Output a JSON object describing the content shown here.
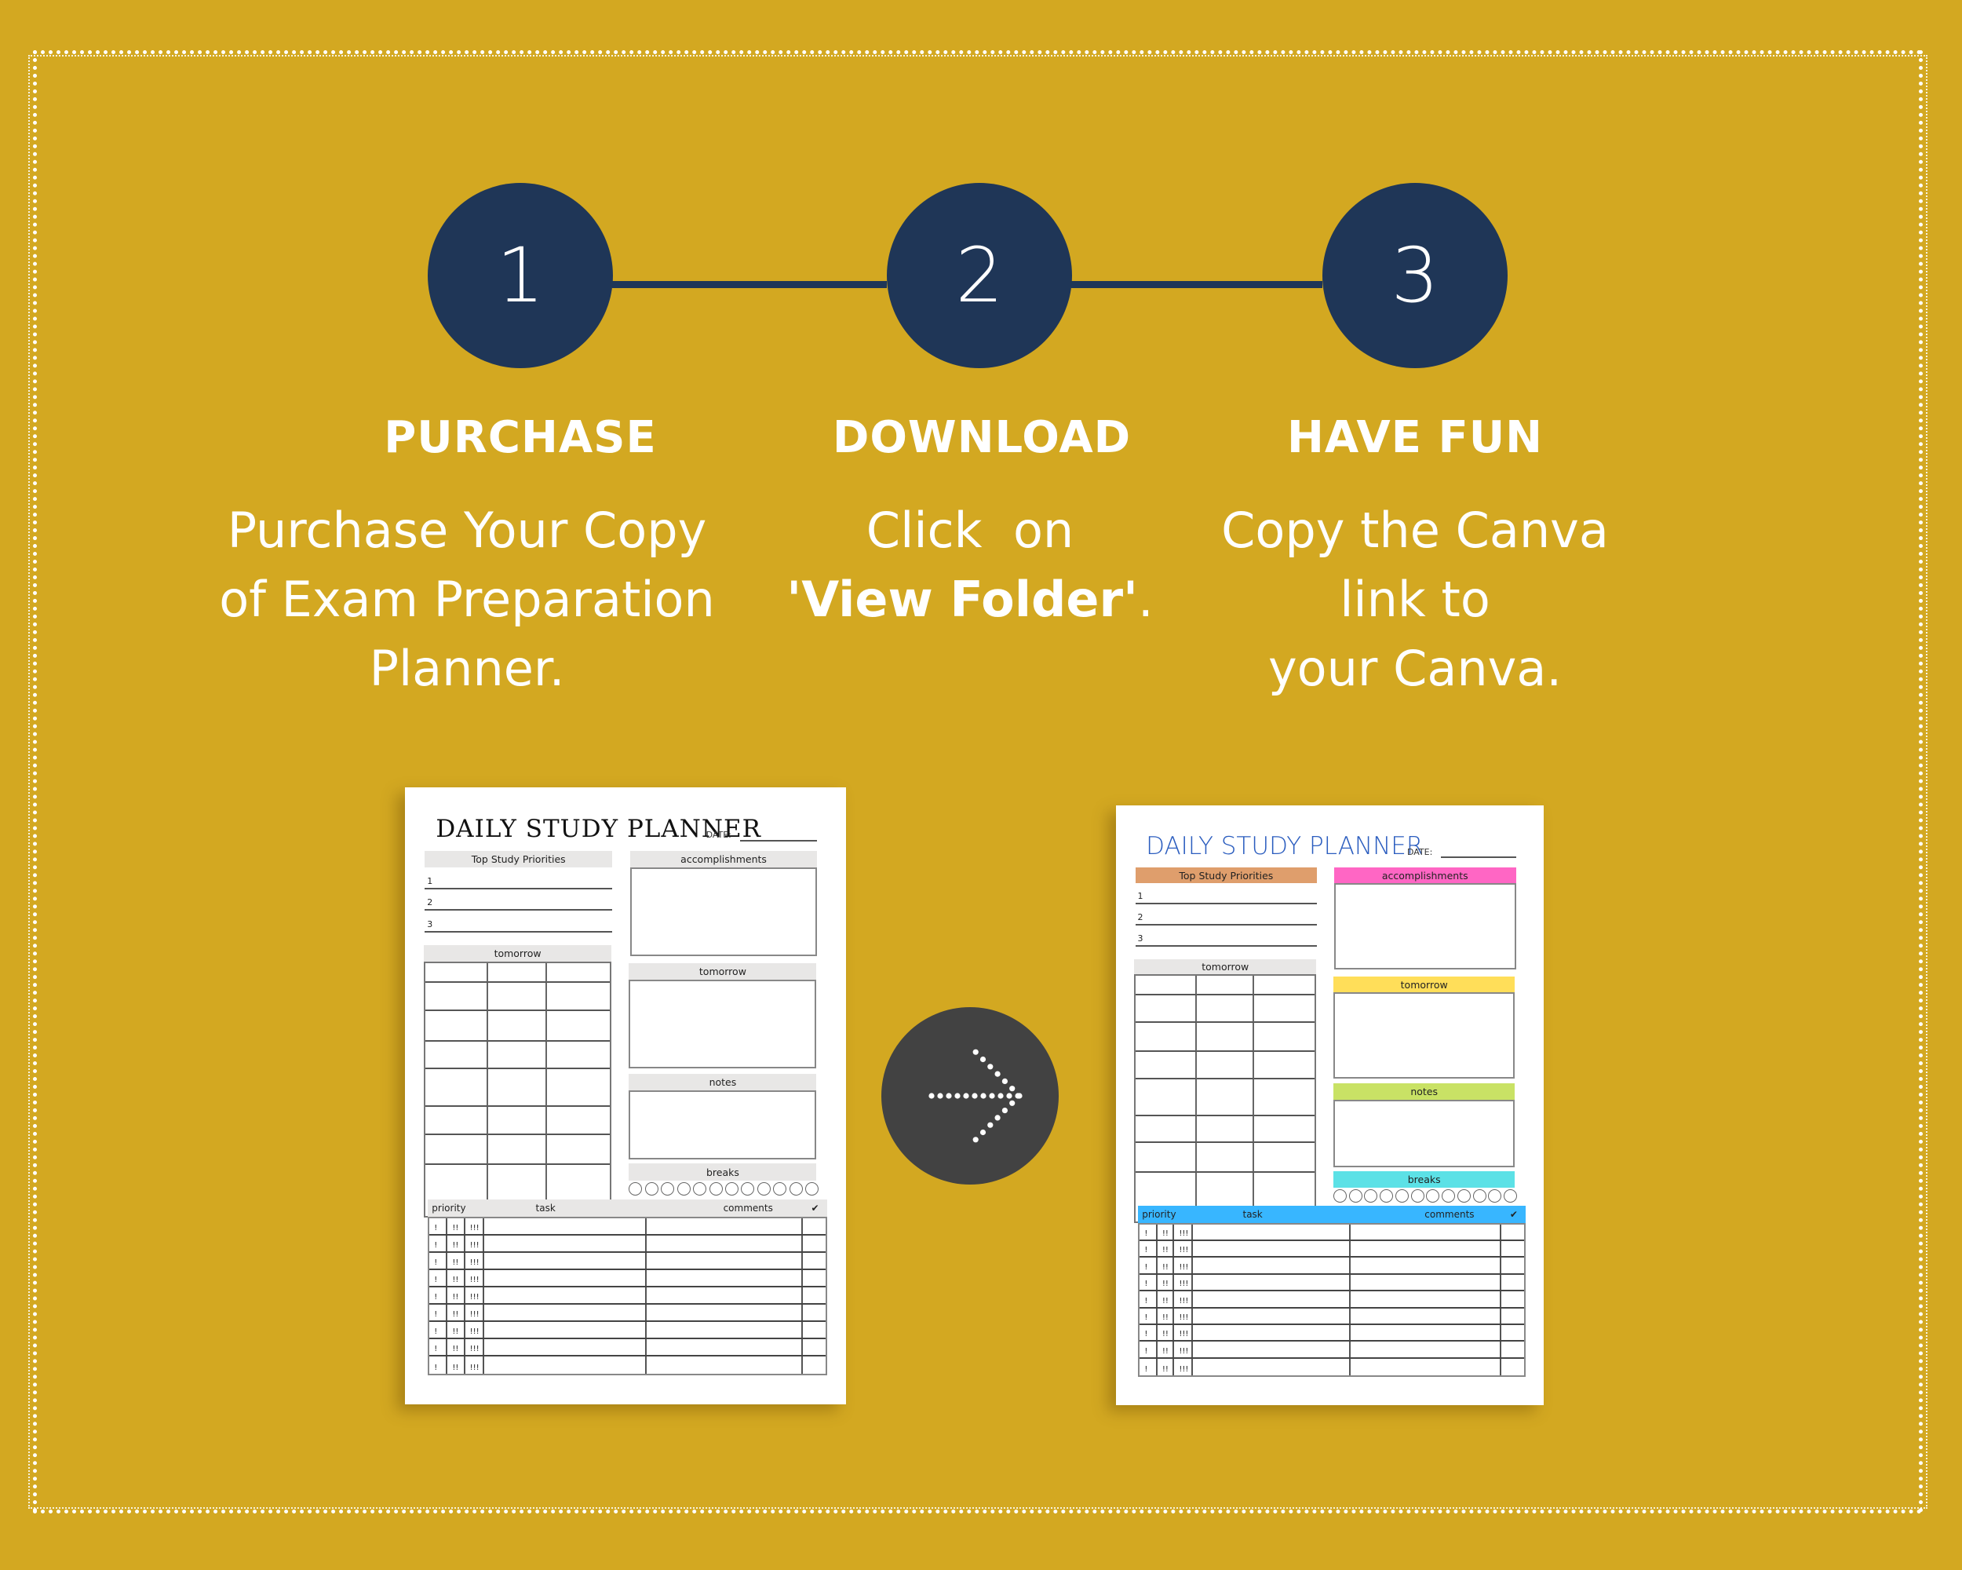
{
  "colors": {
    "background": "#D3A821",
    "step_circle": "#1F3657",
    "arrow_circle": "#424242",
    "text": "#FFFFFF"
  },
  "steps": [
    {
      "number": "1",
      "title": "PURCHASE",
      "lines": [
        "Purchase Your Copy",
        "of Exam Preparation",
        "Planner."
      ]
    },
    {
      "number": "2",
      "title": "DOWNLOAD",
      "lines": [
        "Click  on"
      ],
      "bold_line": "'View Folder'",
      "bold_suffix": "."
    },
    {
      "number": "3",
      "title": "HAVE FUN",
      "lines": [
        "Copy the Canva",
        "link to",
        "your Canva."
      ]
    }
  ],
  "arrow_icon": "dotted-right-arrow",
  "planners": [
    {
      "variant": "plain",
      "title": "DAILY STUDY PLANNER",
      "date_label": "DATE:",
      "priorities_header": "Top Study Priorities",
      "priorities": [
        "1",
        "2",
        "3"
      ],
      "schedule_header": "tomorrow",
      "schedule_rows": 8,
      "schedule_cols": 3,
      "accomplishments_header": "accomplishments",
      "tomorrow_header": "tomorrow",
      "notes_header": "notes",
      "breaks_header": "breaks",
      "break_count": 12,
      "task_headers": {
        "priority": "priority",
        "task": "task",
        "comments": "comments",
        "done": "✔"
      },
      "task_rows": 9,
      "priority_marks": [
        "!",
        "!!",
        "!!!"
      ],
      "header_colors": {
        "priorities": "#E8E7E6",
        "accomplishments": "#E8E7E6",
        "tomorrow": "#E8E7E6",
        "notes": "#E8E7E6",
        "breaks": "#E8E7E6",
        "tasks": "#E8E7E6",
        "schedule": "#E8E7E6"
      }
    },
    {
      "variant": "color",
      "title": "DAILY STUDY PLANNER",
      "date_label": "DATE:",
      "priorities_header": "Top Study Priorities",
      "priorities": [
        "1",
        "2",
        "3"
      ],
      "schedule_header": "tomorrow",
      "schedule_rows": 8,
      "schedule_cols": 3,
      "accomplishments_header": "accomplishments",
      "tomorrow_header": "tomorrow",
      "notes_header": "notes",
      "breaks_header": "breaks",
      "break_count": 12,
      "task_headers": {
        "priority": "priority",
        "task": "task",
        "comments": "comments",
        "done": "✔"
      },
      "task_rows": 9,
      "priority_marks": [
        "!",
        "!!",
        "!!!"
      ],
      "header_colors": {
        "priorities": "#DF9E6C",
        "accomplishments": "#FF66C4",
        "tomorrow": "#FFDE59",
        "notes": "#C9E265",
        "breaks": "#5CE1E6",
        "tasks": "#38B6FF",
        "schedule": "#E8E7E6"
      }
    }
  ]
}
